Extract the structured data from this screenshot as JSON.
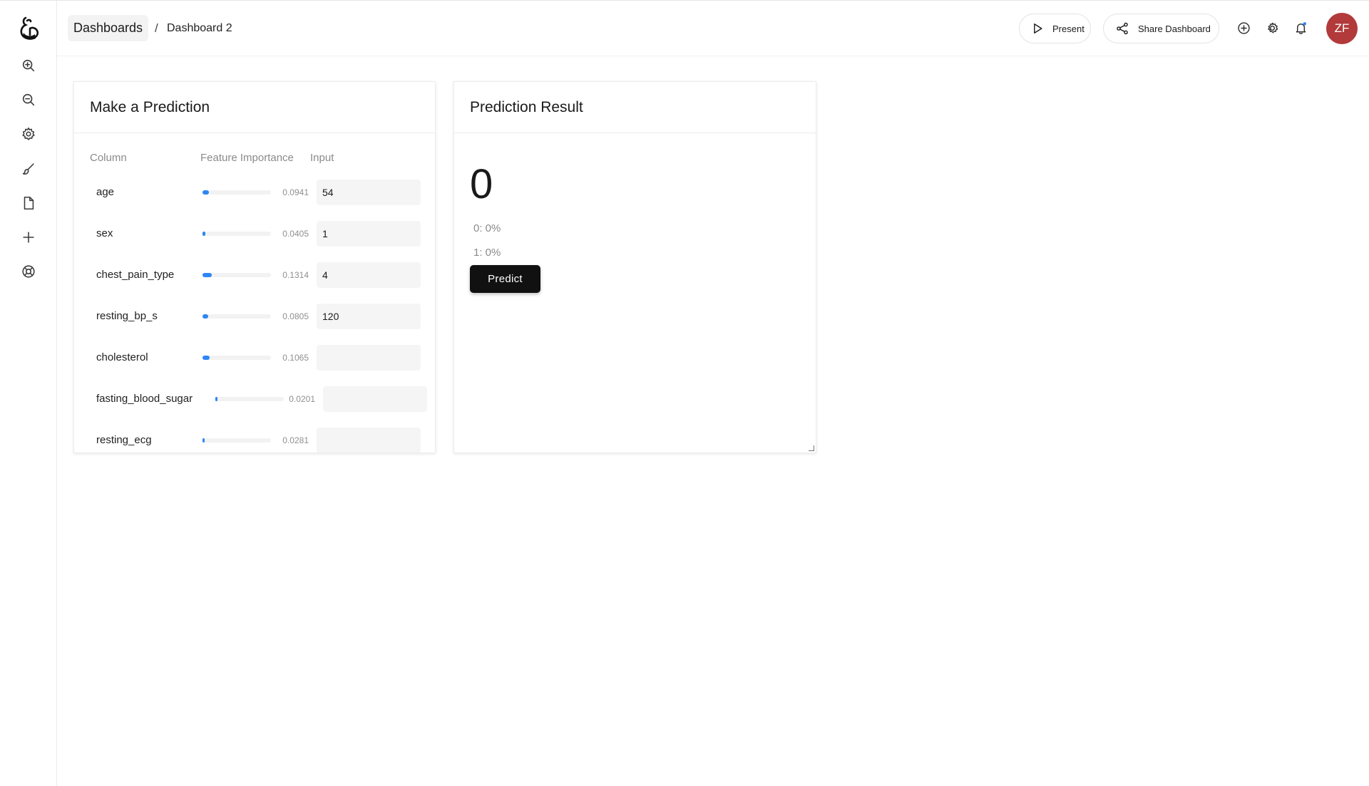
{
  "sidebar": {
    "items": [
      {
        "name": "zoom-in-icon"
      },
      {
        "name": "zoom-out-icon"
      },
      {
        "name": "settings-icon"
      },
      {
        "name": "brush-icon"
      },
      {
        "name": "document-icon"
      },
      {
        "name": "plus-icon"
      },
      {
        "name": "help-lifebuoy-icon"
      }
    ]
  },
  "header": {
    "breadcrumb_root": "Dashboards",
    "breadcrumb_separator": "/",
    "breadcrumb_current": "Dashboard 2",
    "present_label": "Present",
    "share_label": "Share Dashboard",
    "avatar_initials": "ZF",
    "avatar_color": "#b23a3a"
  },
  "prediction_form": {
    "title": "Make a Prediction",
    "col_column": "Column",
    "col_importance": "Feature Importance",
    "col_input": "Input",
    "accent_color": "#2e86f5",
    "rows": [
      {
        "name": "age",
        "importance": "0.0941",
        "input": "54"
      },
      {
        "name": "sex",
        "importance": "0.0405",
        "input": "1"
      },
      {
        "name": "chest_pain_type",
        "importance": "0.1314",
        "input": "4"
      },
      {
        "name": "resting_bp_s",
        "importance": "0.0805",
        "input": "120"
      },
      {
        "name": "cholesterol",
        "importance": "0.1065",
        "input": ""
      },
      {
        "name": "fasting_blood_sugar",
        "importance": "0.0201",
        "input": ""
      },
      {
        "name": "resting_ecg",
        "importance": "0.0281",
        "input": ""
      }
    ]
  },
  "prediction_result": {
    "title": "Prediction Result",
    "value": "0",
    "prob_0": "0: 0%",
    "prob_1": "1: 0%",
    "predict_label": "Predict"
  }
}
